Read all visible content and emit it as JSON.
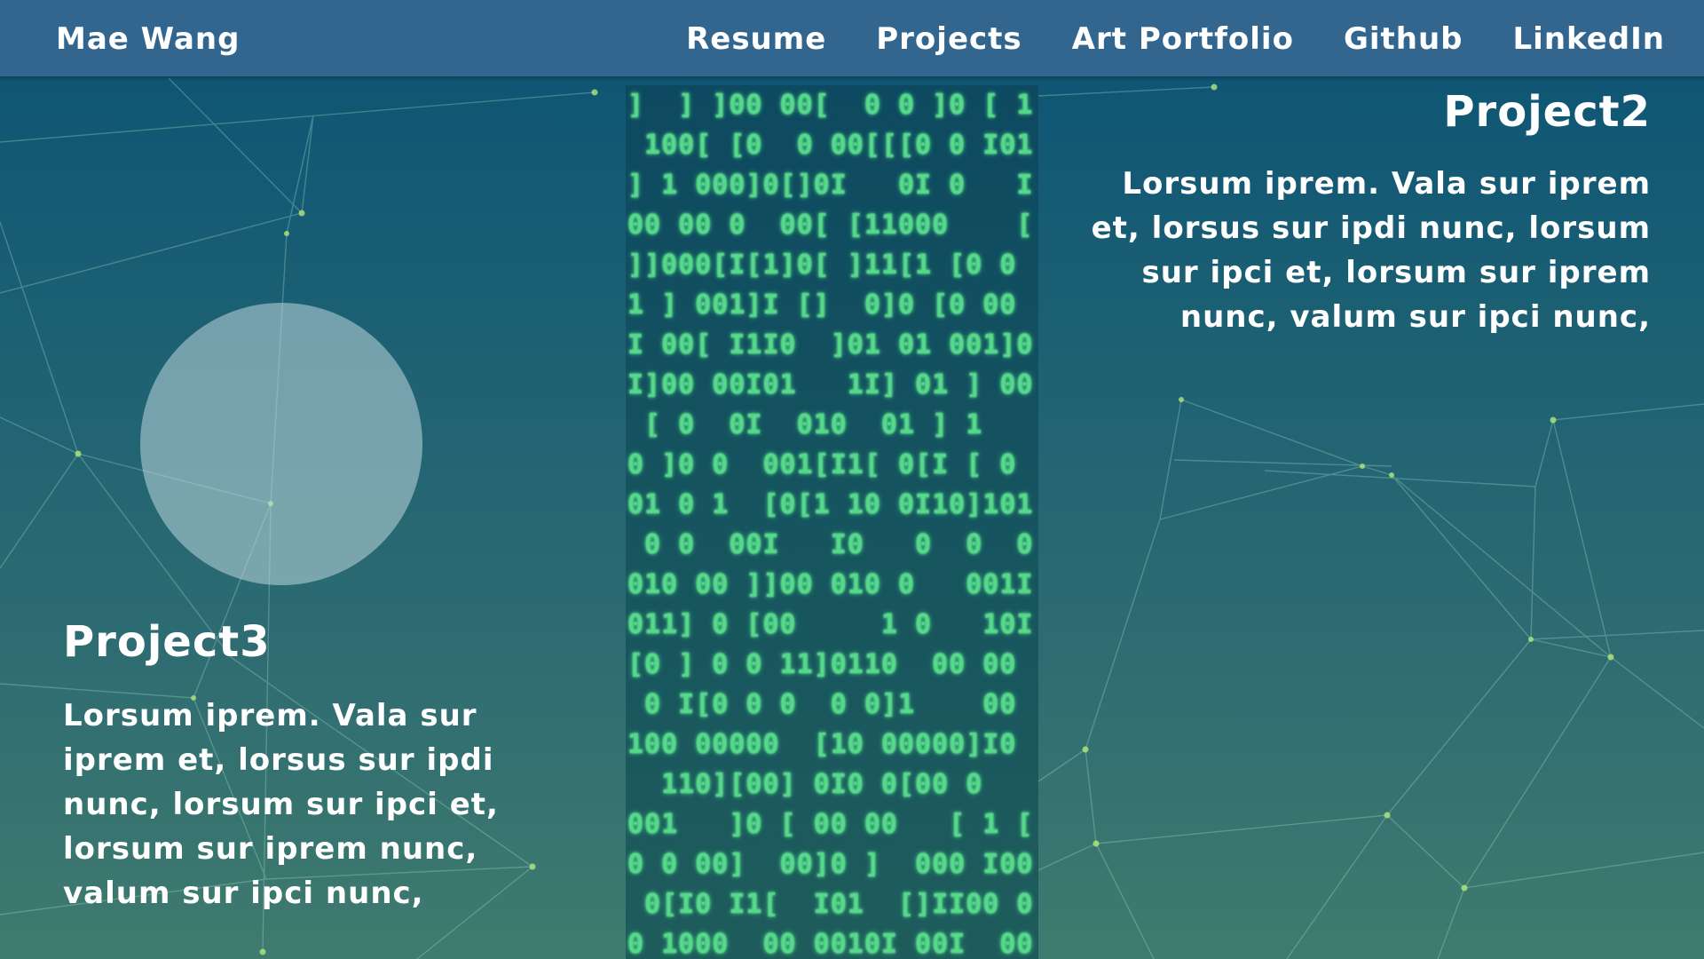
{
  "header": {
    "brand": "Mae Wang",
    "nav": [
      {
        "label": "Resume"
      },
      {
        "label": "Projects"
      },
      {
        "label": "Art Portfolio"
      },
      {
        "label": "Github"
      },
      {
        "label": "LinkedIn"
      }
    ]
  },
  "projects": [
    {
      "title": "Project2",
      "description": "Lorsum iprem. Vala sur iprem et, lorsus sur ipdi nunc, lorsum sur ipci et, lorsum sur iprem nunc, valum sur ipci nunc,"
    },
    {
      "title": "Project3",
      "description": "Lorsum iprem. Vala sur iprem et, lorsus sur ipdi nunc, lorsum sur ipci et, lorsum sur iprem nunc, valum sur ipci nunc,"
    }
  ],
  "colors": {
    "nav_bg": "#33668f",
    "bg_top": "#0b5374",
    "bg_bottom": "#3f7b6e",
    "matrix_glyph": "#56d98a",
    "network_line": "#9fd3c4",
    "network_node": "#b8f078"
  }
}
